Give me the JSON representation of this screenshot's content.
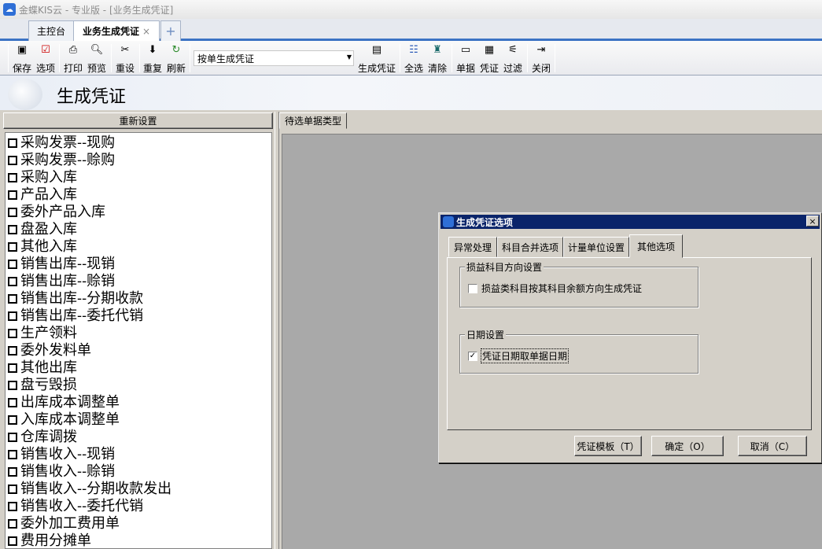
{
  "window": {
    "title": "金蝶KIS云 - 专业版 - [业务生成凭证]"
  },
  "tabs": [
    {
      "label": "主控台"
    },
    {
      "label": "业务生成凭证",
      "close": "×"
    }
  ],
  "tab_add": "+",
  "toolbar": {
    "buttons": [
      {
        "label": "保存",
        "icon": "save-icon"
      },
      {
        "label": "选项",
        "icon": "options-icon"
      },
      {
        "label": "打印",
        "icon": "print-icon"
      },
      {
        "label": "预览",
        "icon": "preview-icon"
      },
      {
        "label": "重设",
        "icon": "reset-icon"
      },
      {
        "label": "重复",
        "icon": "repeat-icon"
      },
      {
        "label": "刷新",
        "icon": "refresh-icon"
      },
      {
        "label": "生成凭证",
        "icon": "generate-voucher-icon"
      },
      {
        "label": "全选",
        "icon": "select-all-icon"
      },
      {
        "label": "清除",
        "icon": "clear-icon"
      },
      {
        "label": "单据",
        "icon": "document-icon"
      },
      {
        "label": "凭证",
        "icon": "voucher-icon"
      },
      {
        "label": "过滤",
        "icon": "filter-icon"
      },
      {
        "label": "关闭",
        "icon": "exit-icon"
      }
    ],
    "select_value": "按单生成凭证"
  },
  "page": {
    "title": "生成凭证"
  },
  "left": {
    "reset_label": "重新设置",
    "items": [
      "采购发票--现购",
      "采购发票--赊购",
      "采购入库",
      "产品入库",
      "委外产品入库",
      "盘盈入库",
      "其他入库",
      "销售出库--现销",
      "销售出库--赊销",
      "销售出库--分期收款",
      "销售出库--委托代销",
      "生产领料",
      "委外发料单",
      "其他出库",
      "盘亏毁损",
      "出库成本调整单",
      "入库成本调整单",
      "仓库调拨",
      "销售收入--现销",
      "销售收入--赊销",
      "销售收入--分期收款发出",
      "销售收入--委托代销",
      "委外加工费用单",
      "费用分摊单"
    ]
  },
  "right": {
    "tab_label": "待选单据类型"
  },
  "dialog": {
    "title": "生成凭证选项",
    "close": "×",
    "tabs": [
      "异常处理",
      "科目合并选项",
      "计量单位设置",
      "其他选项"
    ],
    "active_tab": 3,
    "group_pl": {
      "legend": "损益科目方向设置",
      "checkbox_label": "损益类科目按其科目余额方向生成凭证",
      "checked": false
    },
    "group_date": {
      "legend": "日期设置",
      "checkbox_label": "凭证日期取单据日期",
      "checked": true,
      "check_mark": "✓"
    },
    "buttons": {
      "template": "凭证模板（T）",
      "ok": "确定（O）",
      "cancel": "取消（C）"
    }
  }
}
